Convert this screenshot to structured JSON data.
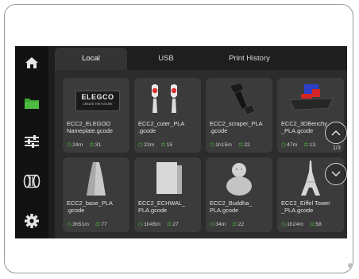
{
  "tabs": [
    {
      "label": "Local"
    },
    {
      "label": "USB"
    },
    {
      "label": "Print History"
    }
  ],
  "sidebar": {
    "items": [
      {
        "icon": "home-icon",
        "active": false
      },
      {
        "icon": "folder-icon",
        "active": true
      },
      {
        "icon": "sliders-icon",
        "active": false
      },
      {
        "icon": "filament-spool-icon",
        "active": false
      },
      {
        "icon": "gear-icon",
        "active": false
      }
    ]
  },
  "files": [
    {
      "name": "ECC2_ELEGOO\nNameplate.gcode",
      "time": "24m",
      "weight": "31",
      "logo_text": "ELEGCO",
      "logo_sub": "CREATE THE FUTURE"
    },
    {
      "name": "ECC2_cuter_PLA\n.gcode",
      "time": "22m",
      "weight": "15"
    },
    {
      "name": "ECC2_scraper_PLA\n.gcode",
      "time": "1h15m",
      "weight": "22"
    },
    {
      "name": "ECC2_3DBenchy\n_PLA.gcode",
      "time": "47m",
      "weight": "13"
    },
    {
      "name": "ECC2_base_PLA\n.gcode",
      "time": "3h51m",
      "weight": "77"
    },
    {
      "name": "ECC2_ECHWAL_\nPLA.gcode",
      "time": "1h45m",
      "weight": "27"
    },
    {
      "name": "ECC2_Buddha_\nPLA.gcode",
      "time": "34m",
      "weight": "22"
    },
    {
      "name": "ECC2_Eiffel Tower\n_PLA.gcode",
      "time": "1h24m",
      "weight": "58"
    }
  ],
  "pager": "1/3",
  "colors": {
    "accent": "#4caf3e",
    "panel": "#2c2c2c",
    "card": "#3b3b3b",
    "sidebar": "#121212"
  }
}
